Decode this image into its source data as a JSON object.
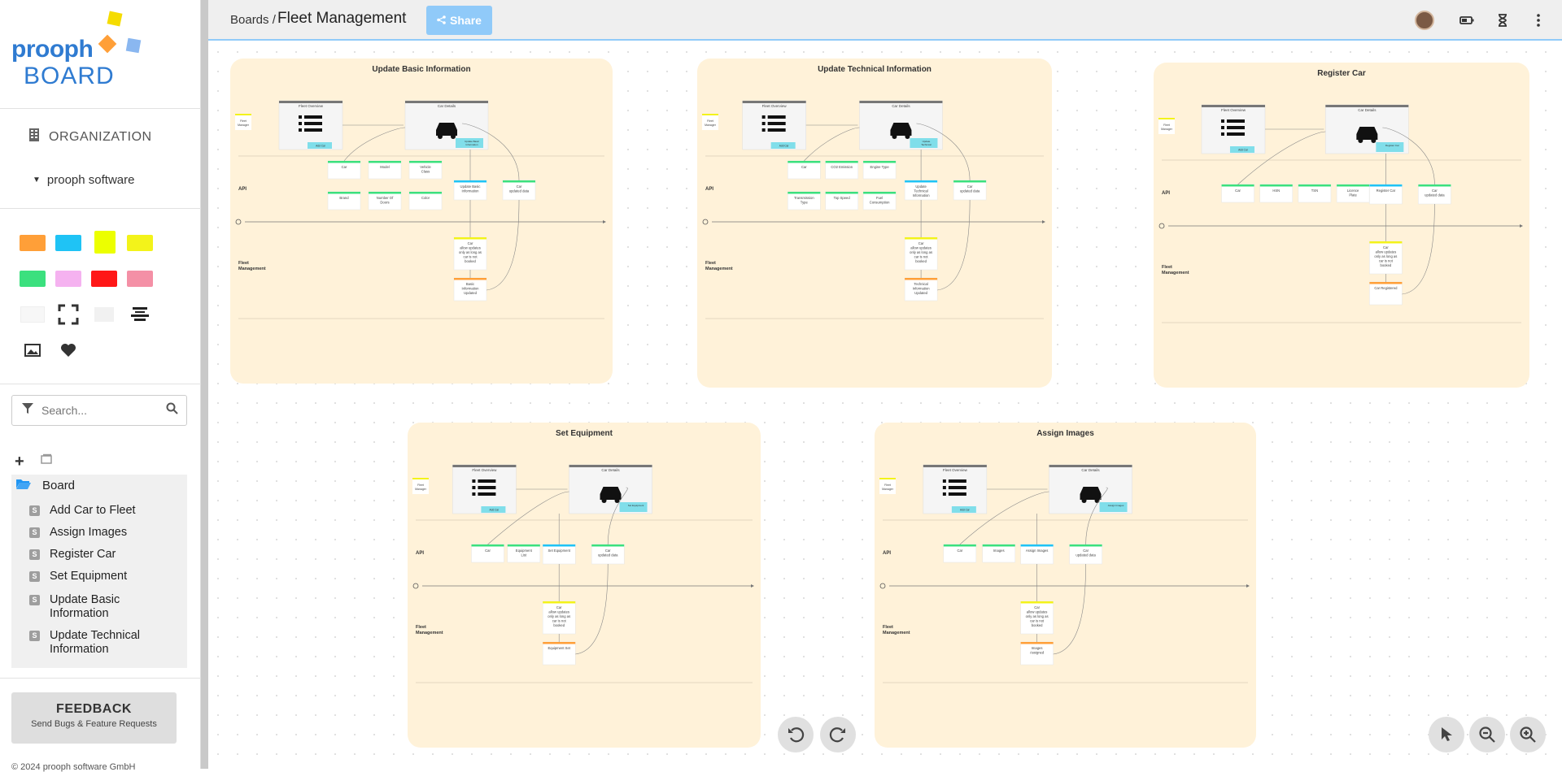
{
  "app": {
    "logo_line1": "prooph",
    "logo_line2": "BOARD"
  },
  "sidebar": {
    "org_label": "ORGANIZATION",
    "workspace": "prooph software",
    "swatches": [
      "#ff9f38",
      "#1fc3f5",
      "#ecff00",
      "#f3f31a",
      "#3be07e",
      "#f5b2f0",
      "#ff1717",
      "#f490a6"
    ],
    "search_placeholder": "Search...",
    "tree": {
      "root": "Board",
      "items": [
        "Add Car to Fleet",
        "Assign Images",
        "Register Car",
        "Set Equipment",
        "Update Basic Information",
        "Update Technical Information"
      ]
    },
    "feedback_title": "FEEDBACK",
    "feedback_sub": "Send Bugs & Feature Requests",
    "copyright": "© 2024 prooph software GmbH"
  },
  "topbar": {
    "crumb": "Boards /",
    "title": "Fleet Management",
    "share_label": "Share"
  },
  "boards": [
    {
      "title": "Update Basic Information",
      "command": "Update Basic Information",
      "event": "Basic Information Updated",
      "ui_btn": "Update Basic Information",
      "fields": [
        "Car",
        "Model",
        "Vehicle Class",
        "Brand",
        "Number Of Doors",
        "Color"
      ]
    },
    {
      "title": "Update Technical Information",
      "command": "Update Technical Information",
      "event": "Technical Information Updated",
      "ui_btn": "Update Technical Information",
      "fields": [
        "Car",
        "CO2 Emission",
        "Engine Type",
        "Transmission Type",
        "Top Speed",
        "Fuel Consumption"
      ]
    },
    {
      "title": "Register Car",
      "command": "Register Car",
      "event": "Car Registered",
      "ui_btn": "Register Car",
      "fields": [
        "Car",
        "HSN",
        "TSN",
        "Licence Plate"
      ]
    },
    {
      "title": "Set Equipment",
      "command": "Set Equipment",
      "event": "Equipment Set",
      "ui_btn": "Set Equipment",
      "fields": [
        "Car",
        "Equipment List"
      ]
    },
    {
      "title": "Assign Images",
      "command": "Assign Images",
      "event": "Images Assigned",
      "ui_btn": "Assign Images",
      "fields": [
        "Car",
        "Images"
      ]
    }
  ],
  "board_common": {
    "fleet_overview": "Fleet Overview",
    "car_details": "Car Details",
    "fleet_manager": "Fleet Manager",
    "add_car": "Add Car",
    "api": "API",
    "lane": "Fleet Management",
    "car": "Car",
    "updated_data": "updated data",
    "policy": "allow updates only as long as car is not booked"
  },
  "icons": {
    "org": "building-icon",
    "search": "search-icon",
    "filter": "filter-icon",
    "undo": "undo-icon",
    "redo": "redo-icon",
    "pointer": "pointer-icon",
    "zoom_out": "zoom-out-icon",
    "zoom_in": "zoom-in-icon"
  }
}
